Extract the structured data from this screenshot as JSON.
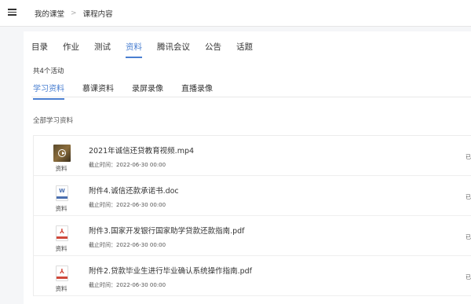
{
  "breadcrumb": {
    "home": "我的课堂",
    "separator": ">",
    "current": "课程内容"
  },
  "tabs": [
    {
      "label": "目录",
      "active": false
    },
    {
      "label": "作业",
      "active": false
    },
    {
      "label": "测试",
      "active": false
    },
    {
      "label": "资料",
      "active": true
    },
    {
      "label": "腾讯会议",
      "active": false
    },
    {
      "label": "公告",
      "active": false
    },
    {
      "label": "话题",
      "active": false
    }
  ],
  "activity_count": "共4个活动",
  "subtabs": [
    {
      "label": "学习资料",
      "active": true
    },
    {
      "label": "慕课资料",
      "active": false
    },
    {
      "label": "录屏录像",
      "active": false
    },
    {
      "label": "直播录像",
      "active": false
    }
  ],
  "section_title": "全部学习资料",
  "deadline_prefix": "截止时间：",
  "items": [
    {
      "type_icon": "video-icon",
      "type_label": "资料",
      "title": "2021年诚信还贷教育视频.mp4",
      "deadline": "截止时间：2022-06-30 00:00",
      "right": "已"
    },
    {
      "type_icon": "word-doc-icon",
      "type_label": "资料",
      "title": "附件4.诚信还款承诺书.doc",
      "deadline": "截止时间：2022-06-30 00:00",
      "right": "已"
    },
    {
      "type_icon": "pdf-icon",
      "type_label": "资料",
      "title": "附件3.国家开发银行国家助学贷款还款指南.pdf",
      "deadline": "截止时间：2022-06-30 00:00",
      "right": "已"
    },
    {
      "type_icon": "pdf-icon",
      "type_label": "资料",
      "title": "附件2.贷款毕业生进行毕业确认系统操作指南.pdf",
      "deadline": "截止时间：2022-06-30 00:00",
      "right": "已"
    }
  ],
  "colors": {
    "accent": "#4a7fd1",
    "pdf": "#d0483b",
    "word": "#4a6fb0"
  }
}
